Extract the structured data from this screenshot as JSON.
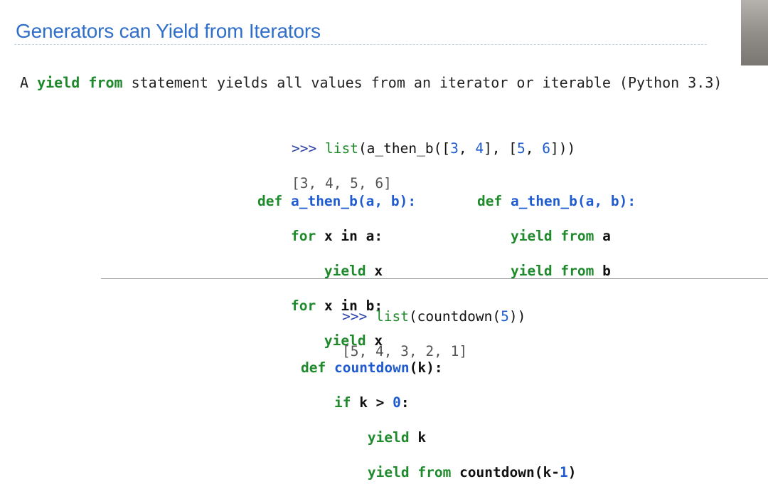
{
  "slide": {
    "title": "Generators can Yield from Iterators",
    "intro": {
      "a": "A ",
      "kw1": "yield",
      "sp": " ",
      "kw2": "from",
      "rest": " statement yields all values from an iterator or iterable (Python 3.3)"
    }
  },
  "example1": {
    "call": {
      "prompt": ">>> ",
      "fn": "list",
      "rest1": "(a_then_b([",
      "n3": "3",
      "c1": ", ",
      "n4": "4",
      "rest2": "], [",
      "n5": "5",
      "c2": ", ",
      "n6": "6",
      "rest3": "]))"
    },
    "output": "[3, 4, 5, 6]",
    "left_def": {
      "def_kw": "def ",
      "sig": "a_then_b(a, b):",
      "for1_kw": "for",
      "for1_rest": " x in a:",
      "yield1_kw": "yield",
      "yield1_rest": " x",
      "for2_kw": "for",
      "for2_rest": " x in b:",
      "yield2_kw": "yield",
      "yield2_rest": " x"
    },
    "right_def": {
      "def_kw": "def ",
      "sig": "a_then_b(a, b):",
      "y1_kw": "yield from",
      "y1_rest": " a",
      "y2_kw": "yield from",
      "y2_rest": " b"
    }
  },
  "example2": {
    "call": {
      "prompt": ">>> ",
      "fn": "list",
      "rest1": "(countdown(",
      "n5": "5",
      "rest2": "))"
    },
    "output": "[5, 4, 3, 2, 1]",
    "def": {
      "def_kw": "def ",
      "fname": "countdown",
      "sig_rest": "(k):",
      "if_kw": "if",
      "if_rest": " k > ",
      "if_num": "0",
      "if_colon": ":",
      "y1_kw": "yield",
      "y1_rest": " k",
      "y2_kw": "yield from",
      "y2_rest1": " countdown(k-",
      "y2_num": "1",
      "y2_rest2": ")"
    }
  }
}
